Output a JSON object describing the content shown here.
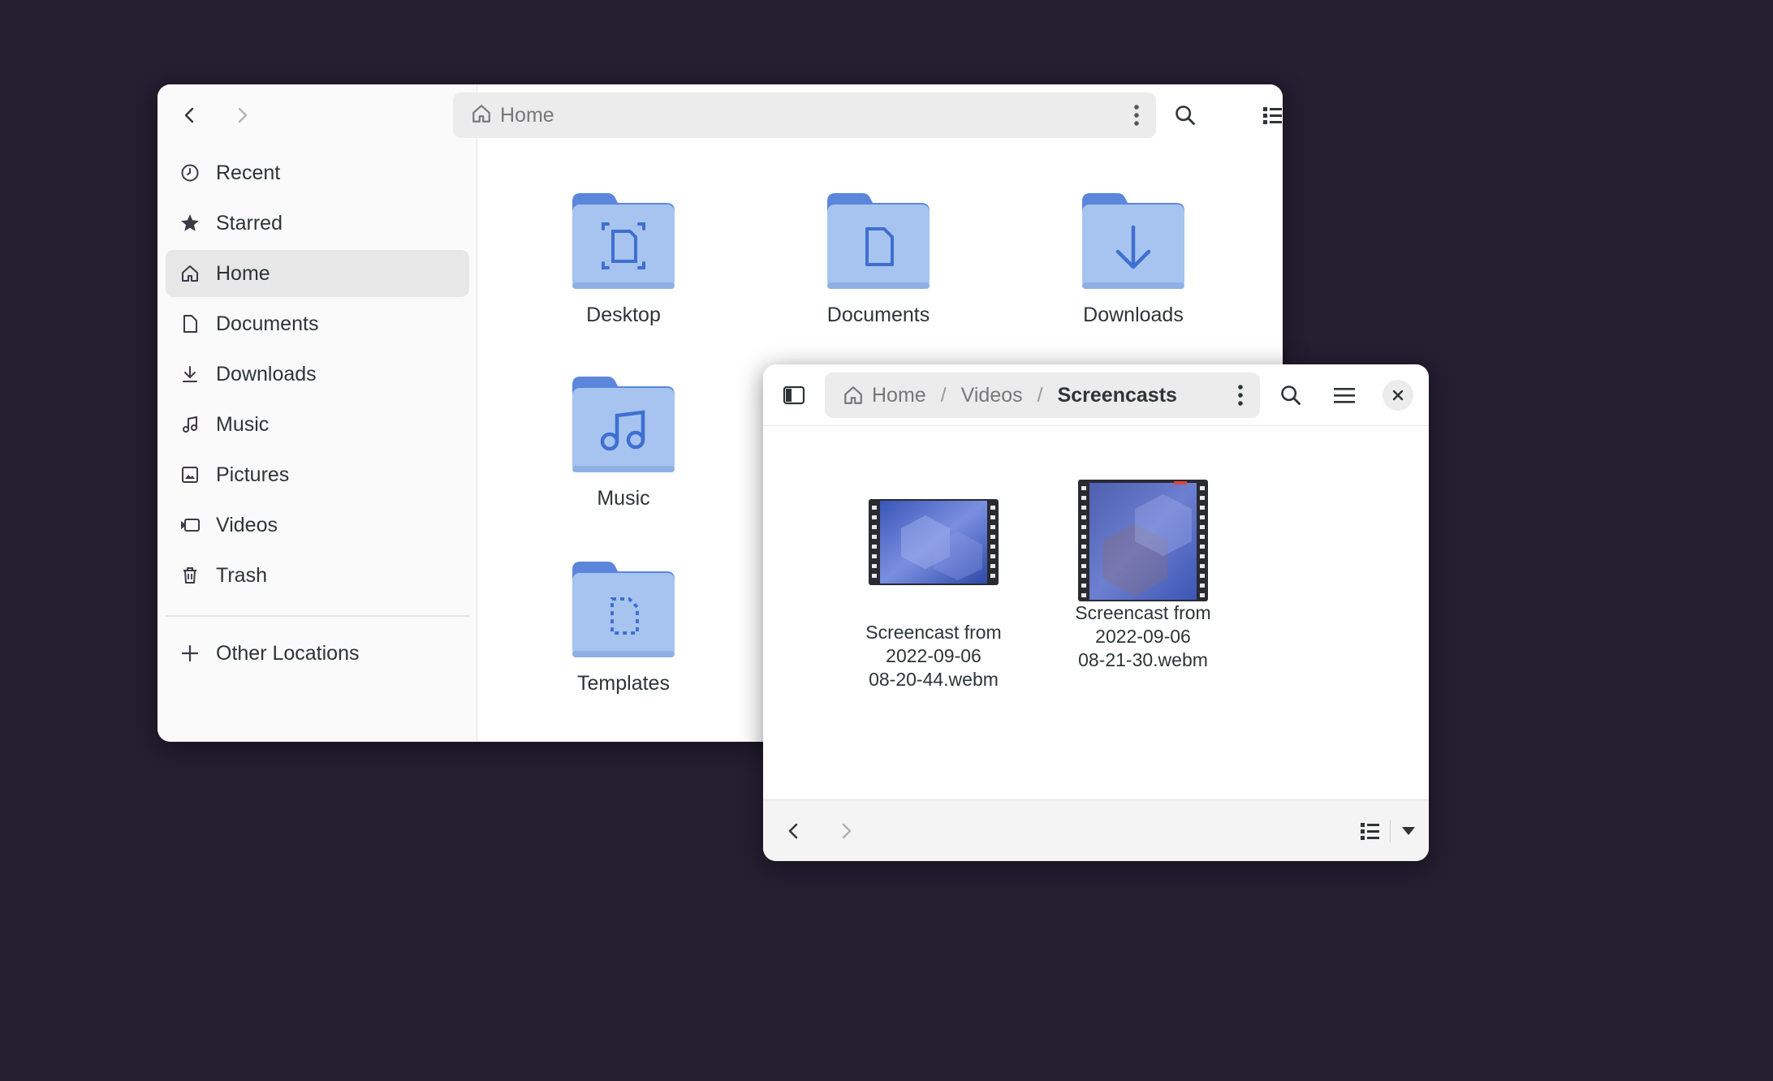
{
  "main_window": {
    "pathbar": {
      "location": "Home",
      "home_icon": "home-icon"
    },
    "sidebar": {
      "items": [
        {
          "label": "Recent",
          "icon": "clock-icon"
        },
        {
          "label": "Starred",
          "icon": "star-icon"
        },
        {
          "label": "Home",
          "icon": "home-icon",
          "active": true
        },
        {
          "label": "Documents",
          "icon": "document-icon"
        },
        {
          "label": "Downloads",
          "icon": "download-icon"
        },
        {
          "label": "Music",
          "icon": "music-icon"
        },
        {
          "label": "Pictures",
          "icon": "picture-icon"
        },
        {
          "label": "Videos",
          "icon": "video-icon"
        },
        {
          "label": "Trash",
          "icon": "trash-icon"
        }
      ],
      "other_locations": {
        "label": "Other Locations",
        "icon": "plus-icon"
      }
    },
    "folders": [
      {
        "label": "Desktop",
        "emblem": "desktop-emblem"
      },
      {
        "label": "Documents",
        "emblem": "document-emblem"
      },
      {
        "label": "Downloads",
        "emblem": "download-emblem"
      },
      {
        "label": "Music",
        "emblem": "music-emblem"
      },
      {
        "label": "Templates",
        "emblem": "template-emblem"
      }
    ]
  },
  "second_window": {
    "breadcrumb": [
      {
        "label": "Home"
      },
      {
        "label": "Videos"
      },
      {
        "label": "Screencasts"
      }
    ],
    "separator": "/",
    "files": [
      {
        "line1": "Screencast from",
        "line2": "2022-09-06",
        "line3": "08-20-44.webm"
      },
      {
        "line1": "Screencast from",
        "line2": "2022-09-06",
        "line3": "08-21-30.webm"
      }
    ]
  },
  "colors": {
    "desktop_bg": "#241f31",
    "folder_back": "#5b86dc",
    "folder_front": "#a6c4ef",
    "folder_emblem": "#3f6fd0"
  }
}
